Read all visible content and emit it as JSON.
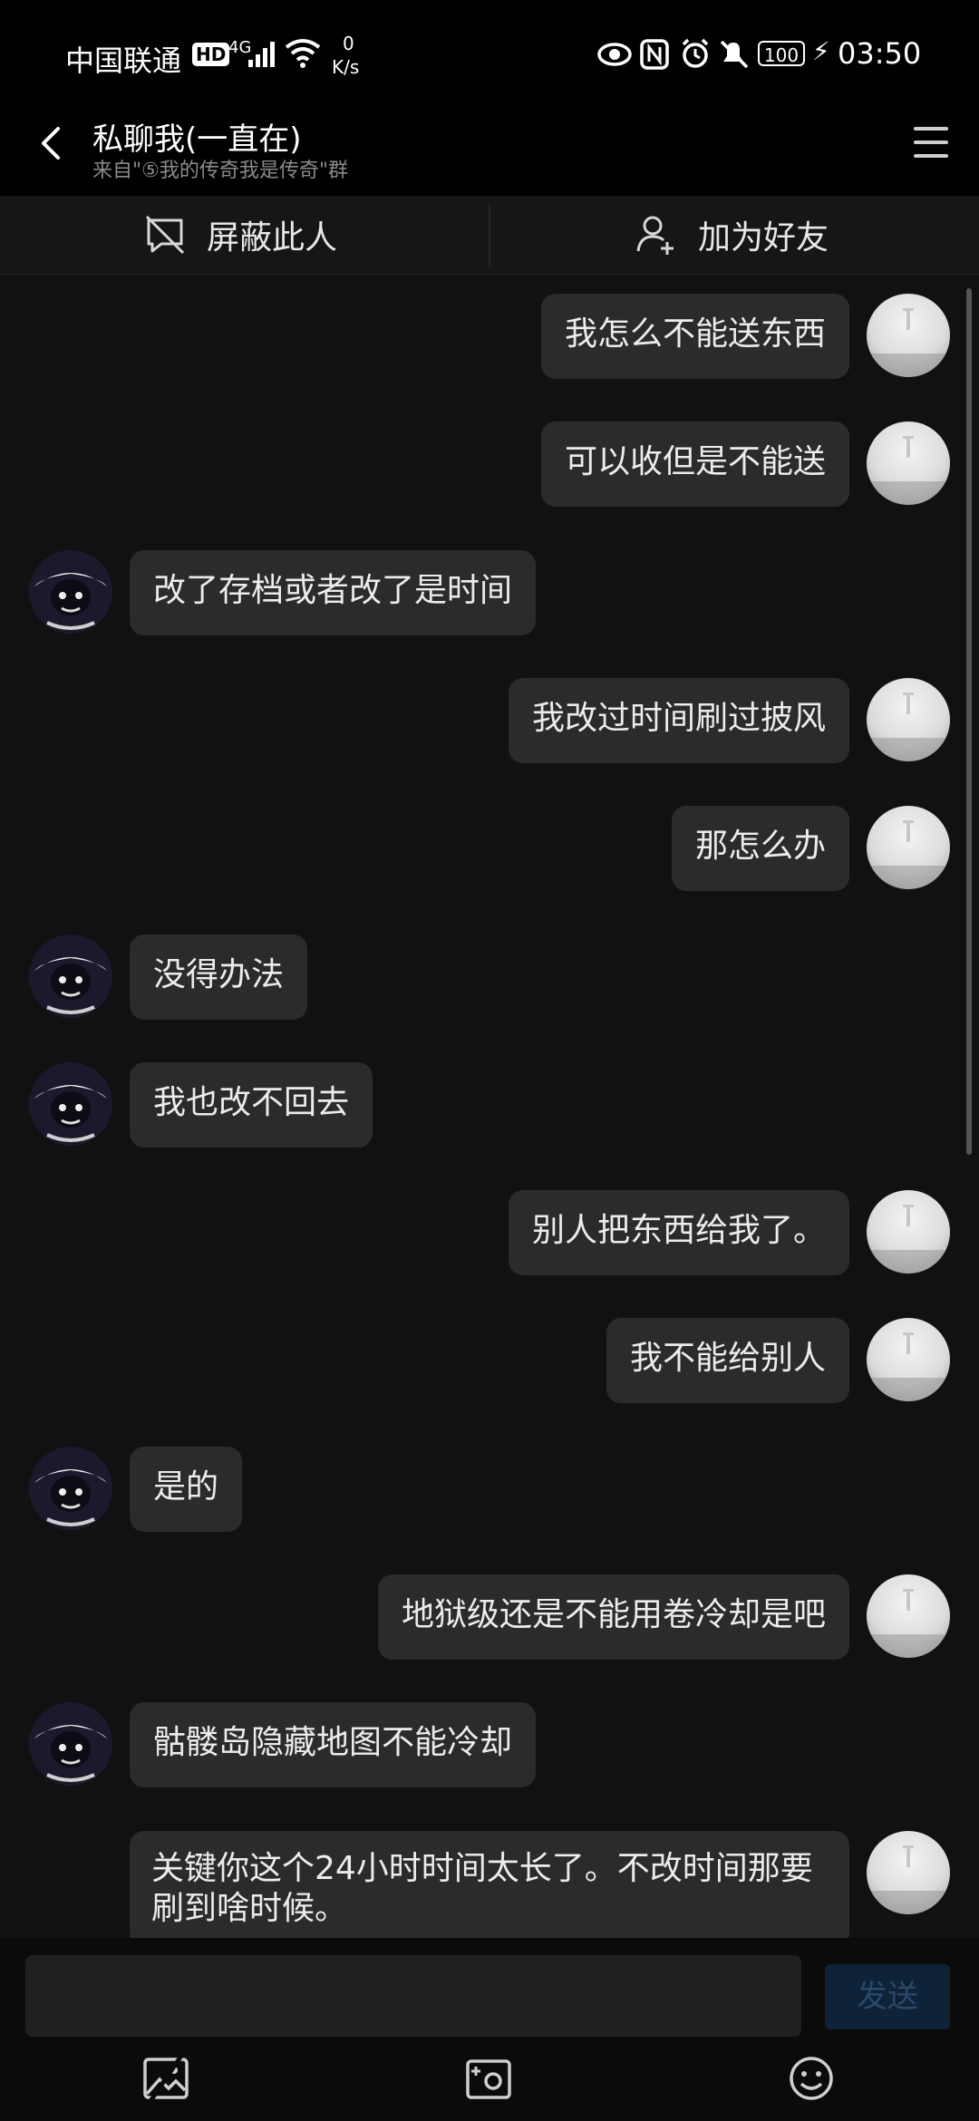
{
  "status_bar": {
    "carrier": "中国联通",
    "hd": "HD",
    "network": "4G",
    "speed_value": "0",
    "speed_unit": "K/s",
    "battery": "100",
    "time": "03:50"
  },
  "header": {
    "title": "私聊我(一直在)",
    "subtitle": "来自\"⑤我的传奇我是传奇\"群"
  },
  "actions": {
    "block": "屏蔽此人",
    "add_friend": "加为好友"
  },
  "messages": [
    {
      "sender": "me",
      "text": "我怎么不能送东西"
    },
    {
      "sender": "me",
      "text": "可以收但是不能送"
    },
    {
      "sender": "them",
      "text": "改了存档或者改了是时间"
    },
    {
      "sender": "me",
      "text": "我改过时间刷过披风"
    },
    {
      "sender": "me",
      "text": "那怎么办"
    },
    {
      "sender": "them",
      "text": "没得办法"
    },
    {
      "sender": "them",
      "text": "我也改不回去"
    },
    {
      "sender": "me",
      "text": "别人把东西给我了。"
    },
    {
      "sender": "me",
      "text": "我不能给别人"
    },
    {
      "sender": "them",
      "text": "是的"
    },
    {
      "sender": "me",
      "text": "地狱级还是不能用卷冷却是吧"
    },
    {
      "sender": "them",
      "text": "骷髅岛隐藏地图不能冷却"
    },
    {
      "sender": "me",
      "text": "关键你这个24小时时间太长了。不改时间那要刷到啥时候。"
    }
  ],
  "input": {
    "placeholder": "",
    "send_label": "发送"
  },
  "colors": {
    "background": "#111111",
    "bubble": "#2b2b2b",
    "send_button": "#0e2238"
  }
}
